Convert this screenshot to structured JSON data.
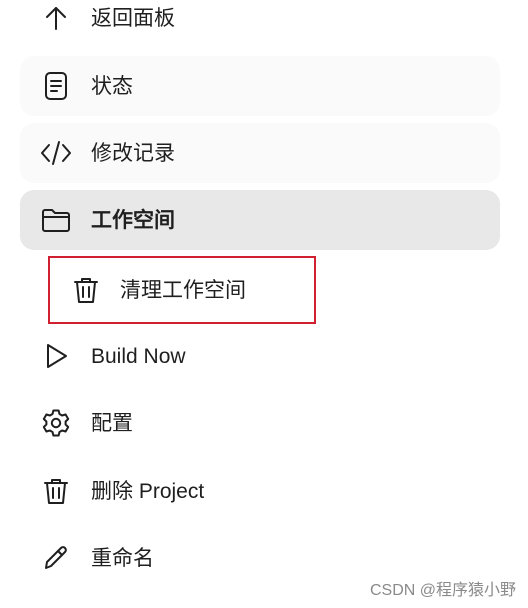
{
  "sidebar": {
    "items": [
      {
        "label": "返回面板",
        "icon": "arrow-up-icon"
      },
      {
        "label": "状态",
        "icon": "document-icon"
      },
      {
        "label": "修改记录",
        "icon": "code-icon"
      },
      {
        "label": "工作空间",
        "icon": "folder-icon"
      },
      {
        "label": "清理工作空间",
        "icon": "trash-icon"
      },
      {
        "label": "Build Now",
        "icon": "play-icon"
      },
      {
        "label": "配置",
        "icon": "gear-icon"
      },
      {
        "label": "删除 Project",
        "icon": "trash-icon"
      },
      {
        "label": "重命名",
        "icon": "pencil-icon"
      }
    ]
  },
  "colors": {
    "active_bg": "#e8e8e8",
    "soft_bg": "#fafafa",
    "highlight_border": "#d01f2e"
  },
  "watermark": "CSDN @程序猿小野"
}
